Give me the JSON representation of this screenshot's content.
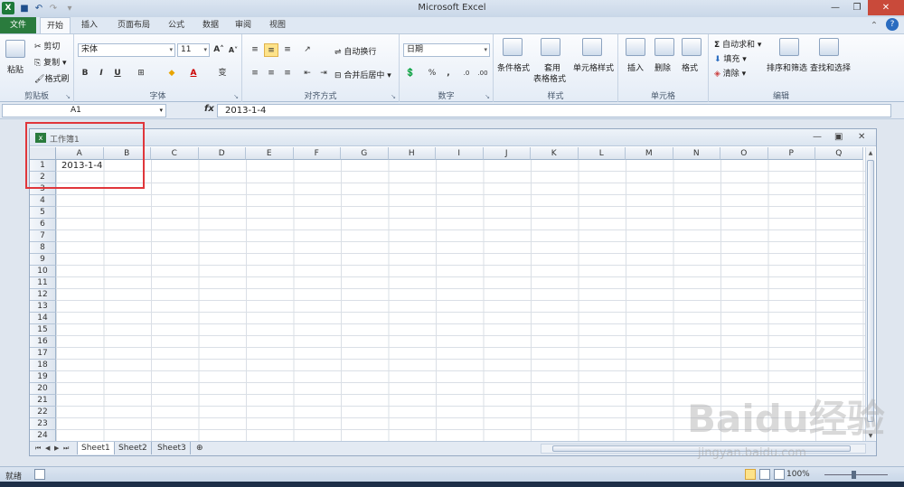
{
  "app": {
    "title": "Microsoft Excel"
  },
  "ribbon_tabs": [
    "文件",
    "开始",
    "插入",
    "页面布局",
    "公式",
    "数据",
    "审阅",
    "视图"
  ],
  "active_tab": "开始",
  "clipboard": {
    "paste": "粘贴",
    "cut": "剪切",
    "copy": "复制",
    "painter": "格式刷",
    "label": "剪贴板"
  },
  "font": {
    "name": "宋体",
    "size": "11",
    "label": "字体",
    "bold": "B",
    "italic": "I",
    "underline": "U",
    "color_letter": "A",
    "increase": "A",
    "decrease": "A",
    "phonetic": "变"
  },
  "alignment": {
    "wrap": "自动换行",
    "merge": "合并后居中",
    "label": "对齐方式"
  },
  "number": {
    "format": "日期",
    "percent": "%",
    "comma": ",",
    "label": "数字"
  },
  "styles": {
    "conditional": "条件格式",
    "table_line1": "套用",
    "table_line2": "表格格式",
    "cell_styles": "单元格样式",
    "label": "样式"
  },
  "cells": {
    "insert": "插入",
    "delete": "删除",
    "format": "格式",
    "label": "单元格"
  },
  "editing": {
    "autosum": "自动求和",
    "fill": "填充",
    "clear": "清除",
    "sort": "排序和筛选",
    "find": "查找和选择",
    "label": "编辑"
  },
  "formula_bar": {
    "name_box": "A1",
    "fx": "fx",
    "value": "2013-1-4"
  },
  "workbook": {
    "name": "工作簿1"
  },
  "columns": [
    "A",
    "B",
    "C",
    "D",
    "E",
    "F",
    "G",
    "H",
    "I",
    "J",
    "K",
    "L",
    "M",
    "N",
    "O",
    "P",
    "Q"
  ],
  "rows": [
    "1",
    "2",
    "3",
    "4",
    "5",
    "6",
    "7",
    "8",
    "9",
    "10",
    "11",
    "12",
    "13",
    "14",
    "15",
    "16",
    "17",
    "18",
    "19",
    "20",
    "21",
    "22",
    "23",
    "24"
  ],
  "cell_a1": "2013-1-4",
  "sheets": [
    "Sheet1",
    "Sheet2",
    "Sheet3"
  ],
  "active_sheet": "Sheet1",
  "status": {
    "ready": "就绪",
    "zoom": "100%"
  },
  "watermark": {
    "brand": "Baidu经验",
    "url": "jingyan.baidu.com"
  },
  "colors": {
    "file_tab": "#2a7b3d",
    "highlight_box": "#e0363b",
    "selected_tool": "#fde38a"
  }
}
